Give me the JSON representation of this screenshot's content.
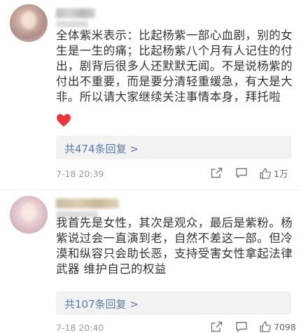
{
  "comments": [
    {
      "text": "全体紫米表示：比起杨紫一部心血剧，别的女生是一生的痛；比起杨紫八个月有人记住的付出，剧背后很多人还默默无闻。不是说杨紫的付出不重要，而是要分清轻重缓急，有大是大非。所以请大家继续关注事情本身，拜托啦",
      "reply_link": "共474条回复 >",
      "time": "7-18 20:39",
      "likes": "1万",
      "has_heart": true
    },
    {
      "text": "我首先是女性，其次是观众，最后是紫粉。杨紫说过会一直演到老，自然不差这一部。但冷漠和纵容只会助长恶，支持受害女性拿起法律武器 维护自己的权益",
      "reply_link": "共107条回复 >",
      "time": "7-18 20:40",
      "likes": "7098"
    }
  ],
  "icons": {
    "share": "share-icon",
    "comment": "comment-icon",
    "like": "thumbs-up-icon",
    "heart": "heart-emoji-icon"
  },
  "colors": {
    "link": "#5b7ba6",
    "reply_bg": "#f2f2f2",
    "heart": "#e8383d"
  }
}
